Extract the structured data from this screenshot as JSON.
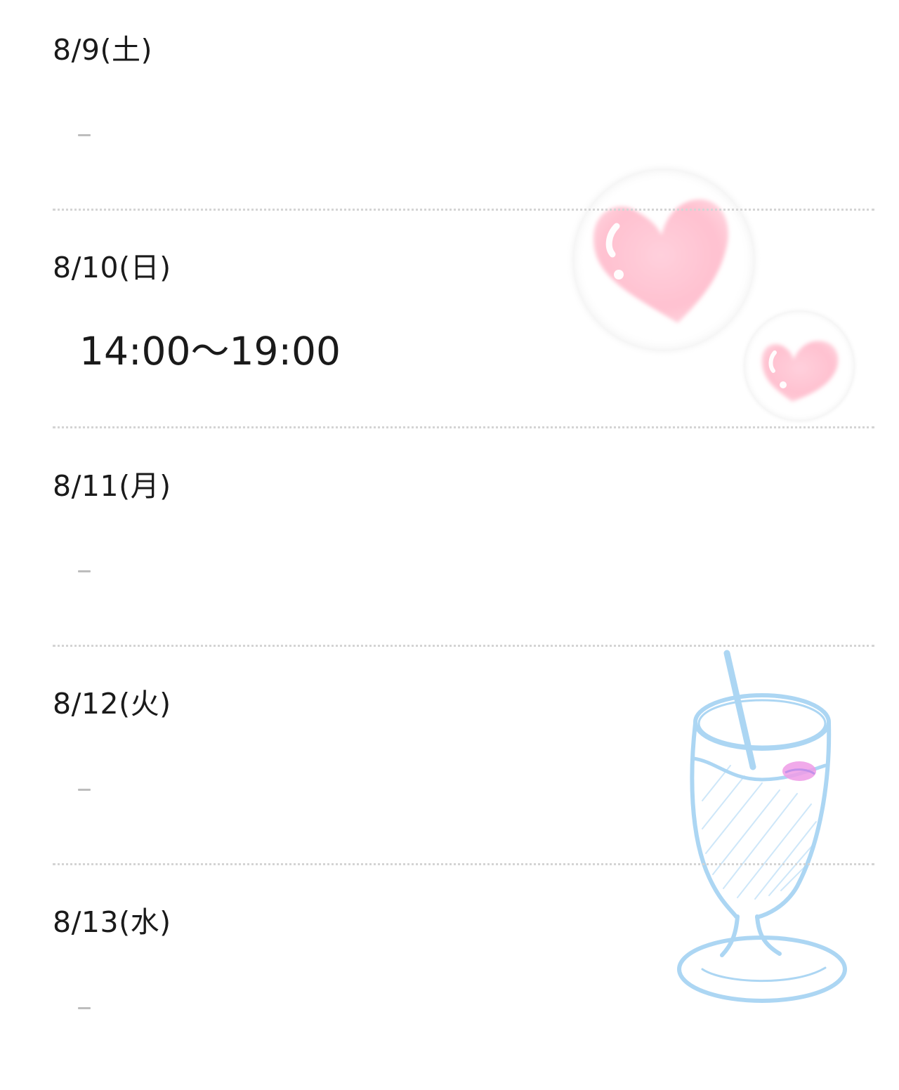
{
  "schedule": {
    "days": [
      {
        "date": "8/9(土)",
        "hours": "-"
      },
      {
        "date": "8/10(日)",
        "hours": "14:00〜19:00"
      },
      {
        "date": "8/11(月)",
        "hours": "-"
      },
      {
        "date": "8/12(火)",
        "hours": "-"
      },
      {
        "date": "8/13(水)",
        "hours": "-"
      }
    ]
  },
  "decorations": {
    "hearts_color": "#ffc6d3",
    "glass_color": "#9fd0f2",
    "lip_color": "#e88be0"
  }
}
